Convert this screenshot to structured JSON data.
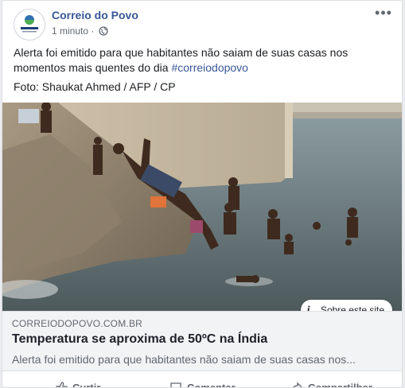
{
  "post": {
    "page_name": "Correio do Povo",
    "time": "1 minuto",
    "separator": " · ",
    "text": "Alerta foi emitido para que habitantes não saiam de suas casas nos momentos mais quentes do dia ",
    "hashtag": "#correiodopovo",
    "photo_credit": "Foto: Shaukat Ahmed / AFP / CP"
  },
  "link_preview": {
    "domain": "CORREIODOPOVO.COM.BR",
    "headline": "Temperatura se aproxima de 50ºC na Índia",
    "description": "Alerta foi emitido para que habitantes não saiam de suas casas nos..."
  },
  "info_button": {
    "label": "Sobre este site",
    "icon": "info-icon"
  },
  "actions": {
    "like": "Curtir",
    "comment": "Comentar",
    "share": "Compartilhar"
  },
  "colors": {
    "link": "#385898",
    "secondary_text": "#606770",
    "card_border": "#dddfe2",
    "link_box_bg": "#f2f3f5"
  }
}
